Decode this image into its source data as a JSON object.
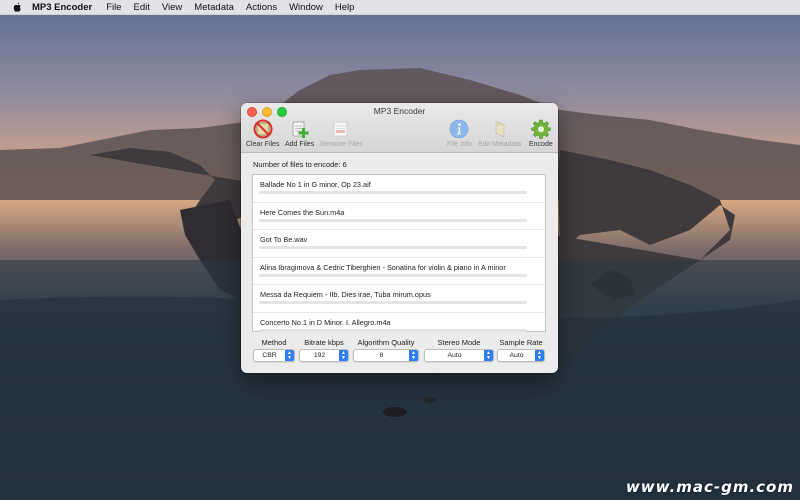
{
  "menubar": {
    "app_name": "MP3 Encoder",
    "items": [
      "File",
      "Edit",
      "View",
      "Metadata",
      "Actions",
      "Window",
      "Help"
    ]
  },
  "window": {
    "title": "MP3 Encoder"
  },
  "toolbar": {
    "clear_files": "Clear Files",
    "add_files": "Add Files",
    "remove_files": "Remove Files",
    "file_info": "File Info",
    "edit_metadata": "Edit Metadata",
    "encode": "Encode"
  },
  "file_count_label": "Number of files to encode: 6",
  "files": [
    {
      "name": "Ballade No 1 in G minor, Op 23.aif",
      "progress": 0
    },
    {
      "name": "Here Comes the Sun.m4a",
      "progress": 0
    },
    {
      "name": "Got To Be.wav",
      "progress": 0
    },
    {
      "name": "Alina Ibragimova & Cedric Tiberghien - Sonatina for violin & piano in A minor",
      "progress": 0
    },
    {
      "name": "Messa da Requiem - IIb. Dies irae, Tuba mirum.opus",
      "progress": 0
    },
    {
      "name": "Concerto No.1 in D Minor. I. Allegro.m4a",
      "progress": 0
    }
  ],
  "settings": {
    "method": {
      "label": "Method",
      "value": "CBR"
    },
    "bitrate": {
      "label": "Bitrate kbps",
      "value": "192"
    },
    "quality": {
      "label": "Algorithm Quality",
      "value": "8"
    },
    "stereo": {
      "label": "Stereo Mode",
      "value": "Auto"
    },
    "sample_rate": {
      "label": "Sample Rate",
      "value": "Auto"
    }
  },
  "watermark": "www.mac-gm.com",
  "colors": {
    "accent": "#2f7df6",
    "info_icon": "#5b9be6",
    "encode_icon": "#6fb63a"
  }
}
